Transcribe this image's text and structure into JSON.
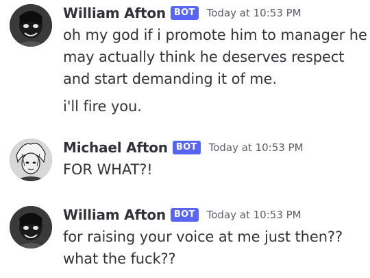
{
  "messages": [
    {
      "author": "William Afton",
      "tag": "BOT",
      "timestamp": "Today at 10:53 PM",
      "lines": [
        "oh my god if i promote him to manager he",
        "may actually think he deserves respect",
        "and start demanding it of me.",
        "i'll fire you."
      ]
    },
    {
      "author": "Michael Afton",
      "tag": "BOT",
      "timestamp": "Today at 10:53 PM",
      "lines": [
        "FOR WHAT?!"
      ]
    },
    {
      "author": "William Afton",
      "tag": "BOT",
      "timestamp": "Today at 10:53 PM",
      "lines": [
        "for raising your voice at me just then??",
        "what the fuck??"
      ]
    }
  ],
  "colors": {
    "bot_tag": "#5865f2",
    "text": "#313338",
    "timestamp": "#5c5e66",
    "background": "#ffffff"
  },
  "icons": {
    "william_avatar": "avatar",
    "michael_avatar": "avatar"
  }
}
